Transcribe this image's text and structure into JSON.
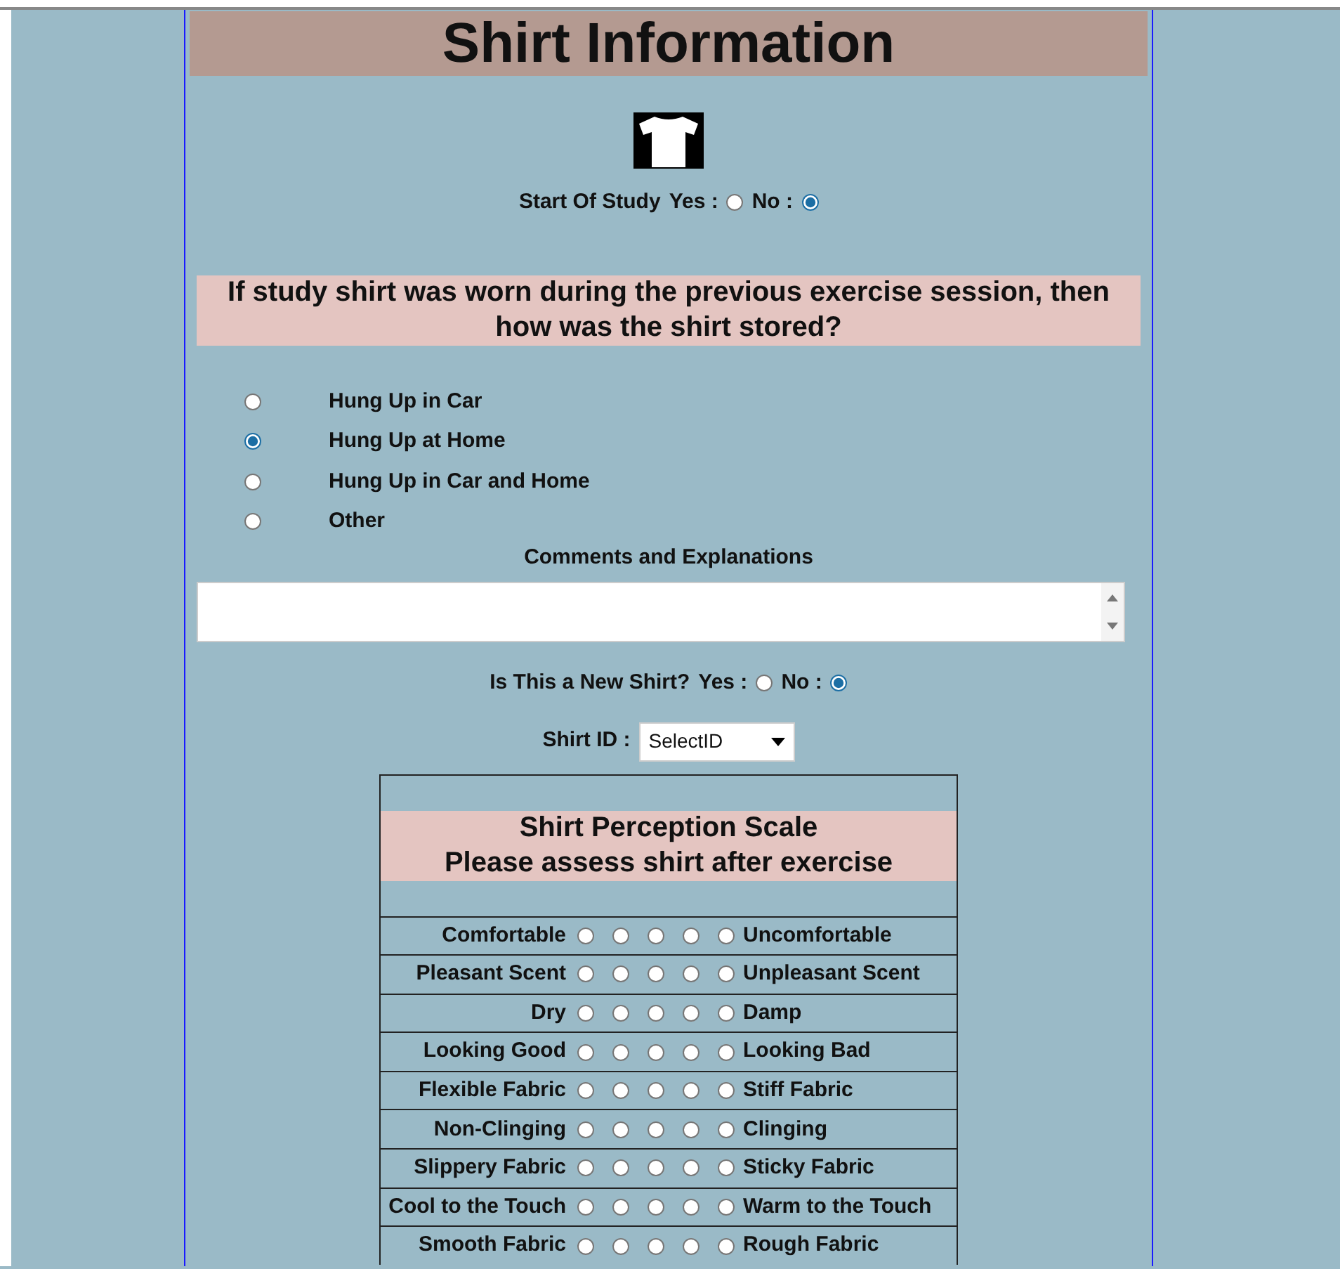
{
  "title": "Shirt Information",
  "start_of_study": {
    "label": "Start Of Study",
    "options": [
      {
        "label": "Yes :",
        "selected": false
      },
      {
        "label": "No :",
        "selected": true
      }
    ]
  },
  "storage_question": {
    "heading": "If study shirt was worn during the previous exercise session, then how was the shirt stored?",
    "options": [
      {
        "label": "Hung Up in Car",
        "selected": false
      },
      {
        "label": "Hung Up at Home",
        "selected": true
      },
      {
        "label": "Hung Up in Car and Home",
        "selected": false
      },
      {
        "label": "Other",
        "selected": false
      }
    ]
  },
  "comments": {
    "label": "Comments and Explanations"
  },
  "new_shirt": {
    "label": "Is This a New Shirt?",
    "options": [
      {
        "label": "Yes :",
        "selected": false
      },
      {
        "label": "No :",
        "selected": true
      }
    ]
  },
  "shirt_id": {
    "label": "Shirt ID :",
    "value": "SelectID"
  },
  "scale": {
    "title": "Shirt Perception Scale",
    "subtitle": "Please assess shirt after exercise",
    "rows": [
      {
        "left": "Comfortable",
        "right": "Uncomfortable",
        "options": [
          {
            "selected": false
          },
          {
            "selected": false
          },
          {
            "selected": false
          },
          {
            "selected": false
          },
          {
            "selected": false
          }
        ]
      },
      {
        "left": "Pleasant Scent",
        "right": "Unpleasant Scent",
        "options": [
          {
            "selected": false
          },
          {
            "selected": false
          },
          {
            "selected": false
          },
          {
            "selected": false
          },
          {
            "selected": false
          }
        ]
      },
      {
        "left": "Dry",
        "right": "Damp",
        "options": [
          {
            "selected": false
          },
          {
            "selected": false
          },
          {
            "selected": false
          },
          {
            "selected": false
          },
          {
            "selected": false
          }
        ]
      },
      {
        "left": "Looking Good",
        "right": "Looking Bad",
        "options": [
          {
            "selected": false
          },
          {
            "selected": false
          },
          {
            "selected": false
          },
          {
            "selected": false
          },
          {
            "selected": false
          }
        ]
      },
      {
        "left": "Flexible Fabric",
        "right": "Stiff Fabric",
        "options": [
          {
            "selected": false
          },
          {
            "selected": false
          },
          {
            "selected": false
          },
          {
            "selected": false
          },
          {
            "selected": false
          }
        ]
      },
      {
        "left": "Non-Clinging",
        "right": "Clinging",
        "options": [
          {
            "selected": false
          },
          {
            "selected": false
          },
          {
            "selected": false
          },
          {
            "selected": false
          },
          {
            "selected": false
          }
        ]
      },
      {
        "left": "Slippery Fabric",
        "right": "Sticky Fabric",
        "options": [
          {
            "selected": false
          },
          {
            "selected": false
          },
          {
            "selected": false
          },
          {
            "selected": false
          },
          {
            "selected": false
          }
        ]
      },
      {
        "left": "Cool to the Touch",
        "right": "Warm to the Touch",
        "options": [
          {
            "selected": false
          },
          {
            "selected": false
          },
          {
            "selected": false
          },
          {
            "selected": false
          },
          {
            "selected": false
          }
        ]
      },
      {
        "left": "Smooth Fabric",
        "right": "Rough Fabric",
        "options": [
          {
            "selected": false
          },
          {
            "selected": false
          },
          {
            "selected": false
          },
          {
            "selected": false
          },
          {
            "selected": false
          }
        ]
      }
    ]
  }
}
